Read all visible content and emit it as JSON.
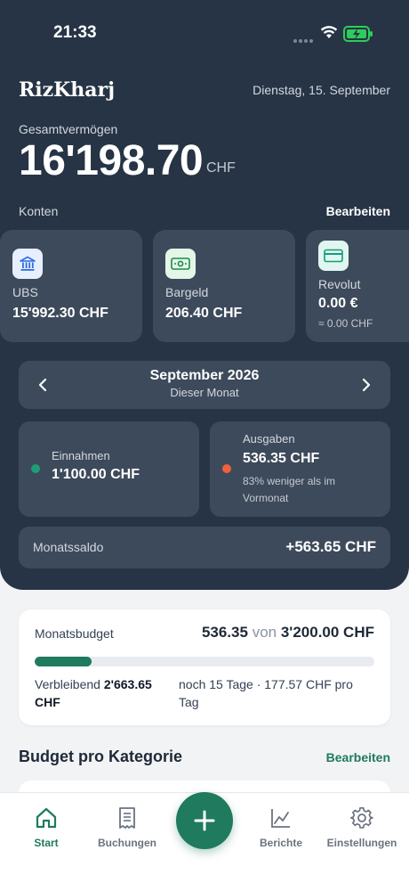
{
  "status": {
    "time": "21:33"
  },
  "header": {
    "app_title": "RizKharj",
    "date": "Dienstag, 15. September"
  },
  "net_worth": {
    "label": "Gesamtvermögen",
    "value": "16'198.70",
    "currency": "CHF"
  },
  "accounts": {
    "label": "Konten",
    "edit_label": "Bearbeiten",
    "items": [
      {
        "name": "UBS",
        "balance": "15'992.30 CHF",
        "icon": "bank-icon"
      },
      {
        "name": "Bargeld",
        "balance": "206.40 CHF",
        "icon": "cash-icon"
      },
      {
        "name": "Revolut",
        "balance": "0.00 €",
        "sub": "≈ 0.00 CHF",
        "icon": "card-icon"
      }
    ]
  },
  "month": {
    "title": "September 2026",
    "subtitle": "Dieser Monat"
  },
  "income": {
    "label": "Einnahmen",
    "value": "1'100.00 CHF",
    "dot_color": "#1f9d73"
  },
  "expenses": {
    "label": "Ausgaben",
    "value": "536.35 CHF",
    "note": "83% weniger als im Vormonat",
    "dot_color": "#f0603a"
  },
  "balance": {
    "label": "Monatssaldo",
    "value": "+563.65 CHF"
  },
  "budget": {
    "label": "Monatsbudget",
    "spent": "536.35",
    "of": "von",
    "total": "3'200.00 CHF",
    "progress_fraction": 0.168,
    "remaining_label": "Verbleibend",
    "remaining_value": "2'663.65 CHF",
    "days_info": "noch 15 Tage · 177.57 CHF pro Tag"
  },
  "categories": {
    "title": "Budget pro Kategorie",
    "edit_label": "Bearbeiten"
  },
  "tabs": [
    {
      "label": "Start",
      "icon": "home-icon",
      "active": true
    },
    {
      "label": "Buchungen",
      "icon": "receipt-icon",
      "active": false
    },
    {
      "label": "Berichte",
      "icon": "chart-icon",
      "active": false
    },
    {
      "label": "Einstellungen",
      "icon": "gear-icon",
      "active": false
    }
  ],
  "fab": {
    "icon": "plus-icon"
  },
  "colors": {
    "hero": "#263445",
    "card": "#3d4a5b",
    "accent": "#1f7a5e"
  }
}
